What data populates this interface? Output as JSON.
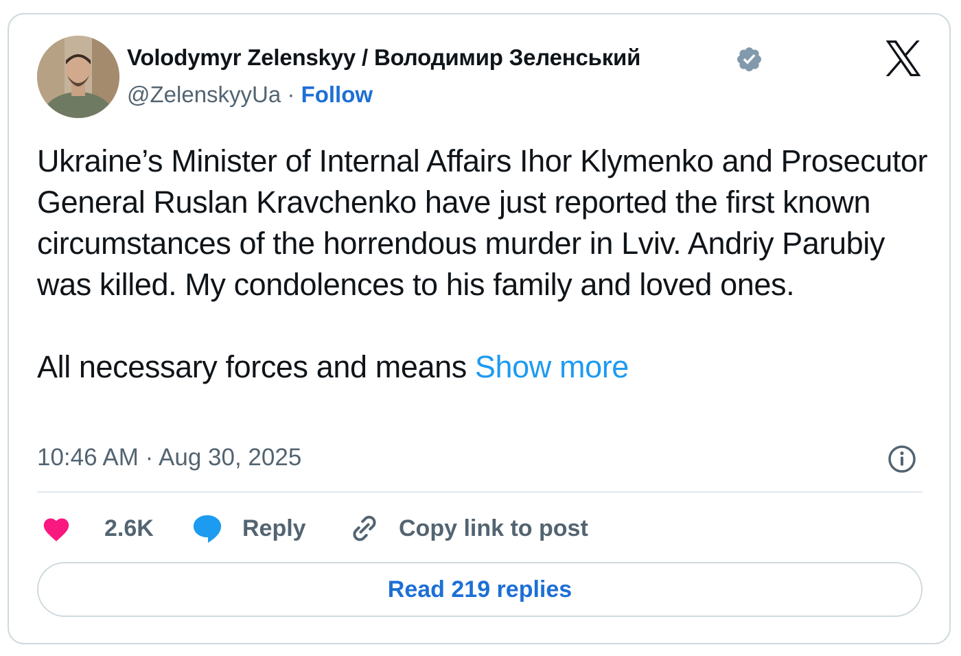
{
  "author": {
    "name": "Volodymyr Zelenskyy / Володимир Зеленський",
    "handle": "@ZelenskyyUa",
    "separator": "·",
    "follow_label": "Follow"
  },
  "post": {
    "paragraph_1": "Ukraine’s Minister of Internal Affairs Ihor Klymenko and Prosecutor General Ruslan Kravchenko have just reported the first known circumstances of the horrendous murder in Lviv. Andriy Parubiy was killed. My condolences to his family and loved ones.",
    "paragraph_2": "All necessary forces and means",
    "show_more_label": "Show more",
    "timestamp": "10:46 AM · Aug 30, 2025"
  },
  "actions": {
    "like_count": "2.6K",
    "reply_label": "Reply",
    "copy_link_label": "Copy link to post"
  },
  "read_replies_label": "Read 219 replies",
  "icons": {
    "verified": "verified-badge-icon",
    "x_logo": "x-logo-icon",
    "info": "info-icon",
    "like": "heart-icon",
    "reply": "speech-bubble-icon",
    "copy": "link-icon"
  },
  "colors": {
    "link_blue": "#1d6fd6",
    "show_more_blue": "#1d9bf0",
    "heart_pink": "#f91880",
    "text_dark": "#0f1419",
    "text_muted": "#536471",
    "border": "#cfd9de",
    "verified_gray": "#829aab"
  }
}
